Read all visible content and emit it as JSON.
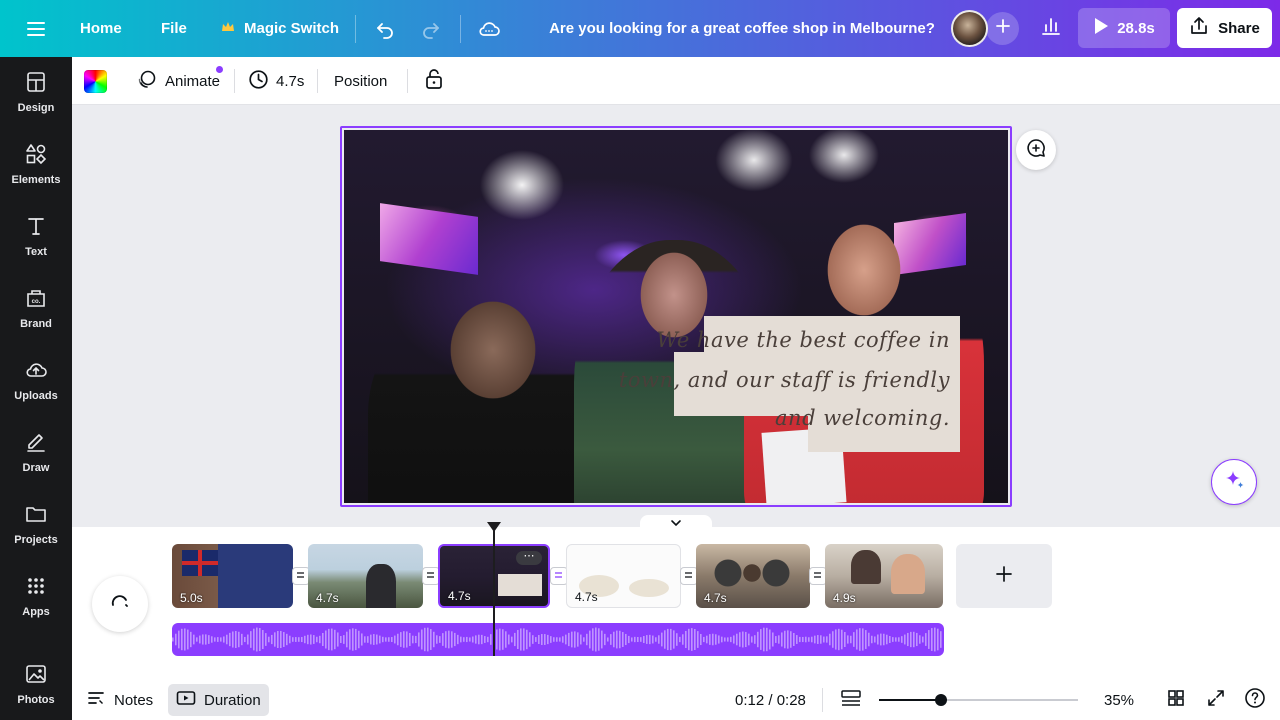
{
  "header": {
    "menu_icon": "hamburger-icon",
    "home": "Home",
    "file": "File",
    "magic_switch": "Magic Switch",
    "doc_title": "Are you looking for a great coffee shop in Melbourne?",
    "play_duration": "28.8s",
    "share": "Share"
  },
  "toolbar": {
    "animate": "Animate",
    "duration": "4.7s",
    "position": "Position"
  },
  "sidebar": {
    "items": [
      {
        "label": "Design",
        "icon": "design-icon"
      },
      {
        "label": "Elements",
        "icon": "elements-icon"
      },
      {
        "label": "Text",
        "icon": "text-icon"
      },
      {
        "label": "Brand",
        "icon": "brand-icon"
      },
      {
        "label": "Uploads",
        "icon": "upload-icon"
      },
      {
        "label": "Draw",
        "icon": "draw-icon"
      },
      {
        "label": "Projects",
        "icon": "folder-icon"
      },
      {
        "label": "Apps",
        "icon": "apps-icon"
      },
      {
        "label": "Photos",
        "icon": "photos-icon"
      }
    ]
  },
  "canvas": {
    "caption_lines": [
      "We have the best coffee in",
      "town, and our staff is friendly",
      "and welcoming."
    ]
  },
  "timeline": {
    "pages": [
      {
        "duration": "5.0s"
      },
      {
        "duration": "4.7s"
      },
      {
        "duration": "4.7s",
        "selected": true
      },
      {
        "duration": "4.7s"
      },
      {
        "duration": "4.7s"
      },
      {
        "duration": "4.9s"
      }
    ]
  },
  "footer": {
    "notes": "Notes",
    "duration": "Duration",
    "time": "0:12 / 0:28",
    "zoom": "35%",
    "zoom_level": 0.31
  },
  "colors": {
    "accent": "#8b3dff",
    "header_gradient_start": "#00c4cc",
    "header_gradient_end": "#7d2ae8",
    "sidebar_bg": "#18191b"
  }
}
